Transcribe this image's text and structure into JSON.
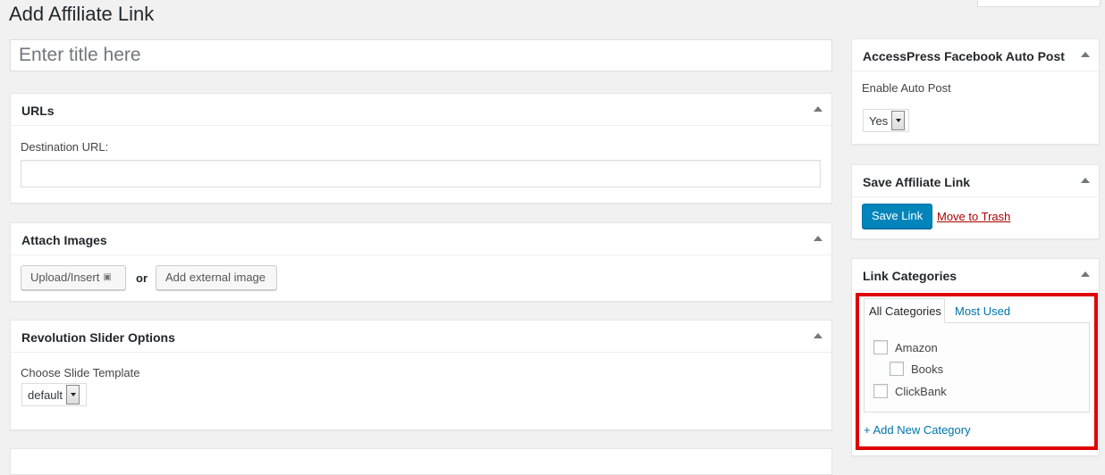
{
  "page": {
    "title": "Add Affiliate Link"
  },
  "title_field": {
    "placeholder": "Enter title here"
  },
  "urls_box": {
    "title": "URLs",
    "destination_label": "Destination URL:",
    "destination_value": ""
  },
  "attach_images_box": {
    "title": "Attach Images",
    "upload_button": "Upload/Insert",
    "or_text": "or",
    "external_button": "Add external image"
  },
  "revslider_box": {
    "title": "Revolution Slider Options",
    "template_label": "Choose Slide Template",
    "template_value": "default"
  },
  "facebook_box": {
    "title": "AccessPress Facebook Auto Post",
    "enable_label": "Enable Auto Post",
    "enable_value": "Yes"
  },
  "save_box": {
    "title": "Save Affiliate Link",
    "save_button": "Save Link",
    "trash_link": "Move to Trash"
  },
  "categories_box": {
    "title": "Link Categories",
    "tabs": [
      {
        "label": "All Categories",
        "active": true
      },
      {
        "label": "Most Used",
        "active": false
      }
    ],
    "categories": [
      {
        "label": "Amazon",
        "checked": false,
        "level": 0
      },
      {
        "label": "Books",
        "checked": false,
        "level": 1
      },
      {
        "label": "ClickBank",
        "checked": false,
        "level": 0
      }
    ],
    "add_new": "+ Add New Category"
  },
  "colors": {
    "background": "#f1f1f1",
    "primary_button": "#0085ba",
    "link": "#0073aa",
    "trash": "#a00000",
    "highlight": "#e00000"
  }
}
